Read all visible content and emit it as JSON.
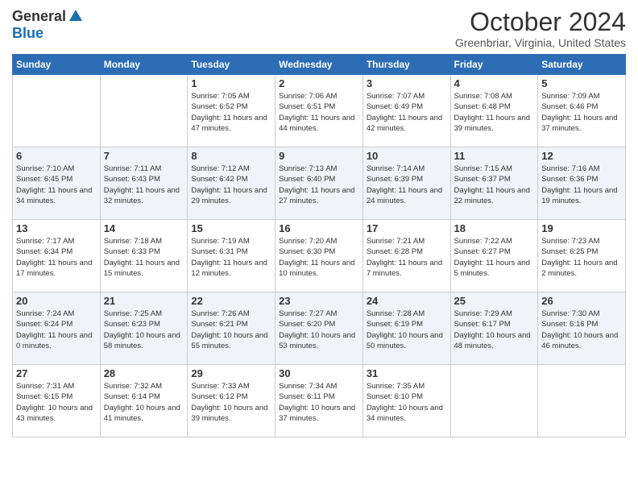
{
  "header": {
    "logo_general": "General",
    "logo_blue": "Blue",
    "month_title": "October 2024",
    "subtitle": "Greenbriar, Virginia, United States"
  },
  "days_of_week": [
    "Sunday",
    "Monday",
    "Tuesday",
    "Wednesday",
    "Thursday",
    "Friday",
    "Saturday"
  ],
  "weeks": [
    [
      {
        "day": "",
        "sunrise": "",
        "sunset": "",
        "daylight": ""
      },
      {
        "day": "",
        "sunrise": "",
        "sunset": "",
        "daylight": ""
      },
      {
        "day": "1",
        "sunrise": "Sunrise: 7:05 AM",
        "sunset": "Sunset: 6:52 PM",
        "daylight": "Daylight: 11 hours and 47 minutes."
      },
      {
        "day": "2",
        "sunrise": "Sunrise: 7:06 AM",
        "sunset": "Sunset: 6:51 PM",
        "daylight": "Daylight: 11 hours and 44 minutes."
      },
      {
        "day": "3",
        "sunrise": "Sunrise: 7:07 AM",
        "sunset": "Sunset: 6:49 PM",
        "daylight": "Daylight: 11 hours and 42 minutes."
      },
      {
        "day": "4",
        "sunrise": "Sunrise: 7:08 AM",
        "sunset": "Sunset: 6:48 PM",
        "daylight": "Daylight: 11 hours and 39 minutes."
      },
      {
        "day": "5",
        "sunrise": "Sunrise: 7:09 AM",
        "sunset": "Sunset: 6:46 PM",
        "daylight": "Daylight: 11 hours and 37 minutes."
      }
    ],
    [
      {
        "day": "6",
        "sunrise": "Sunrise: 7:10 AM",
        "sunset": "Sunset: 6:45 PM",
        "daylight": "Daylight: 11 hours and 34 minutes."
      },
      {
        "day": "7",
        "sunrise": "Sunrise: 7:11 AM",
        "sunset": "Sunset: 6:43 PM",
        "daylight": "Daylight: 11 hours and 32 minutes."
      },
      {
        "day": "8",
        "sunrise": "Sunrise: 7:12 AM",
        "sunset": "Sunset: 6:42 PM",
        "daylight": "Daylight: 11 hours and 29 minutes."
      },
      {
        "day": "9",
        "sunrise": "Sunrise: 7:13 AM",
        "sunset": "Sunset: 6:40 PM",
        "daylight": "Daylight: 11 hours and 27 minutes."
      },
      {
        "day": "10",
        "sunrise": "Sunrise: 7:14 AM",
        "sunset": "Sunset: 6:39 PM",
        "daylight": "Daylight: 11 hours and 24 minutes."
      },
      {
        "day": "11",
        "sunrise": "Sunrise: 7:15 AM",
        "sunset": "Sunset: 6:37 PM",
        "daylight": "Daylight: 11 hours and 22 minutes."
      },
      {
        "day": "12",
        "sunrise": "Sunrise: 7:16 AM",
        "sunset": "Sunset: 6:36 PM",
        "daylight": "Daylight: 11 hours and 19 minutes."
      }
    ],
    [
      {
        "day": "13",
        "sunrise": "Sunrise: 7:17 AM",
        "sunset": "Sunset: 6:34 PM",
        "daylight": "Daylight: 11 hours and 17 minutes."
      },
      {
        "day": "14",
        "sunrise": "Sunrise: 7:18 AM",
        "sunset": "Sunset: 6:33 PM",
        "daylight": "Daylight: 11 hours and 15 minutes."
      },
      {
        "day": "15",
        "sunrise": "Sunrise: 7:19 AM",
        "sunset": "Sunset: 6:31 PM",
        "daylight": "Daylight: 11 hours and 12 minutes."
      },
      {
        "day": "16",
        "sunrise": "Sunrise: 7:20 AM",
        "sunset": "Sunset: 6:30 PM",
        "daylight": "Daylight: 11 hours and 10 minutes."
      },
      {
        "day": "17",
        "sunrise": "Sunrise: 7:21 AM",
        "sunset": "Sunset: 6:28 PM",
        "daylight": "Daylight: 11 hours and 7 minutes."
      },
      {
        "day": "18",
        "sunrise": "Sunrise: 7:22 AM",
        "sunset": "Sunset: 6:27 PM",
        "daylight": "Daylight: 11 hours and 5 minutes."
      },
      {
        "day": "19",
        "sunrise": "Sunrise: 7:23 AM",
        "sunset": "Sunset: 6:25 PM",
        "daylight": "Daylight: 11 hours and 2 minutes."
      }
    ],
    [
      {
        "day": "20",
        "sunrise": "Sunrise: 7:24 AM",
        "sunset": "Sunset: 6:24 PM",
        "daylight": "Daylight: 11 hours and 0 minutes."
      },
      {
        "day": "21",
        "sunrise": "Sunrise: 7:25 AM",
        "sunset": "Sunset: 6:23 PM",
        "daylight": "Daylight: 10 hours and 58 minutes."
      },
      {
        "day": "22",
        "sunrise": "Sunrise: 7:26 AM",
        "sunset": "Sunset: 6:21 PM",
        "daylight": "Daylight: 10 hours and 55 minutes."
      },
      {
        "day": "23",
        "sunrise": "Sunrise: 7:27 AM",
        "sunset": "Sunset: 6:20 PM",
        "daylight": "Daylight: 10 hours and 53 minutes."
      },
      {
        "day": "24",
        "sunrise": "Sunrise: 7:28 AM",
        "sunset": "Sunset: 6:19 PM",
        "daylight": "Daylight: 10 hours and 50 minutes."
      },
      {
        "day": "25",
        "sunrise": "Sunrise: 7:29 AM",
        "sunset": "Sunset: 6:17 PM",
        "daylight": "Daylight: 10 hours and 48 minutes."
      },
      {
        "day": "26",
        "sunrise": "Sunrise: 7:30 AM",
        "sunset": "Sunset: 6:16 PM",
        "daylight": "Daylight: 10 hours and 46 minutes."
      }
    ],
    [
      {
        "day": "27",
        "sunrise": "Sunrise: 7:31 AM",
        "sunset": "Sunset: 6:15 PM",
        "daylight": "Daylight: 10 hours and 43 minutes."
      },
      {
        "day": "28",
        "sunrise": "Sunrise: 7:32 AM",
        "sunset": "Sunset: 6:14 PM",
        "daylight": "Daylight: 10 hours and 41 minutes."
      },
      {
        "day": "29",
        "sunrise": "Sunrise: 7:33 AM",
        "sunset": "Sunset: 6:12 PM",
        "daylight": "Daylight: 10 hours and 39 minutes."
      },
      {
        "day": "30",
        "sunrise": "Sunrise: 7:34 AM",
        "sunset": "Sunset: 6:11 PM",
        "daylight": "Daylight: 10 hours and 37 minutes."
      },
      {
        "day": "31",
        "sunrise": "Sunrise: 7:35 AM",
        "sunset": "Sunset: 6:10 PM",
        "daylight": "Daylight: 10 hours and 34 minutes."
      },
      {
        "day": "",
        "sunrise": "",
        "sunset": "",
        "daylight": ""
      },
      {
        "day": "",
        "sunrise": "",
        "sunset": "",
        "daylight": ""
      }
    ]
  ]
}
